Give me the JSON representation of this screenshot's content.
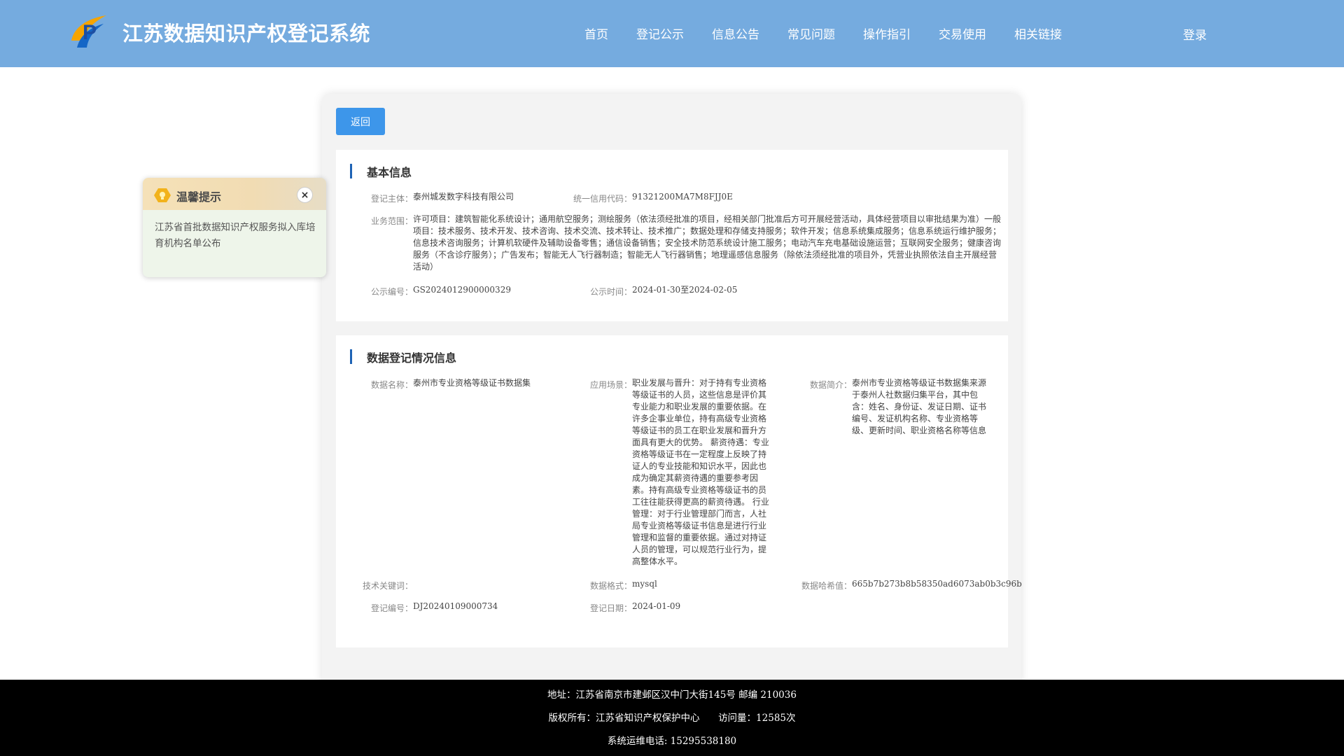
{
  "header": {
    "site_title": "江苏数据知识产权登记系统",
    "nav": [
      "首页",
      "登记公示",
      "信息公告",
      "常见问题",
      "操作指引",
      "交易使用",
      "相关链接"
    ],
    "login": "登录",
    "background": "#75abdf"
  },
  "back_button": "返回",
  "basic_info": {
    "title": "基本信息",
    "subject_label": "登记主体：",
    "subject_value": "泰州城发数字科技有限公司",
    "credit_code_label": "统一信用代码：",
    "credit_code_value": "91321200MA7M8FJJ0E",
    "scope_label": "业务范围：",
    "scope_value": "许可项目：建筑智能化系统设计；通用航空服务；测绘服务（依法须经批准的项目，经相关部门批准后方可开展经营活动，具体经营项目以审批结果为准）一般项目：技术服务、技术开发、技术咨询、技术交流、技术转让、技术推广；数据处理和存储支持服务；软件开发；信息系统集成服务；信息系统运行维护服务；信息技术咨询服务；计算机软硬件及辅助设备零售；通信设备销售；安全技术防范系统设计施工服务；电动汽车充电基础设施运营；互联网安全服务；健康咨询服务（不含诊疗服务）；广告发布；智能无人飞行器制造；智能无人飞行器销售；地理遥感信息服务（除依法须经批准的项目外，凭营业执照依法自主开展经营活动）",
    "notice_no_label": "公示编号：",
    "notice_no_value": "GS2024012900000329",
    "notice_time_label": "公示时间：",
    "notice_time_value": "2024-01-30至2024-02-05"
  },
  "data_info": {
    "title": "数据登记情况信息",
    "name_label": "数据名称：",
    "name_value": "泰州市专业资格等级证书数据集",
    "scenario_label": "应用场景：",
    "scenario_value": "职业发展与晋升：对于持有专业资格等级证书的人员，这些信息是评价其专业能力和职业发展的重要依据。在许多企事业单位，持有高级专业资格等级证书的员工在职业发展和晋升方面具有更大的优势。 薪资待遇：专业资格等级证书在一定程度上反映了持证人的专业技能和知识水平，因此也成为确定其薪资待遇的重要参考因素。持有高级专业资格等级证书的员工往往能获得更高的薪资待遇。 行业管理：对于行业管理部门而言，人社局专业资格等级证书信息是进行行业管理和监督的重要依据。通过对持证人员的管理，可以规范行业行为，提高整体水平。",
    "intro_label": "数据简介：",
    "intro_value": "泰州市专业资格等级证书数据集来源于泰州人社数据归集平台，其中包含：姓名、身份证、发证日期、证书编号、发证机构名称、专业资格等级、更新时间、职业资格名称等信息",
    "keywords_label": "技术关键词：",
    "keywords_value": "",
    "format_label": "数据格式：",
    "format_value": "mysql",
    "hash_label": "数据哈希值：",
    "hash_value": "665b7b273b8b58350ad6073ab0b3c96b",
    "reg_no_label": "登记编号：",
    "reg_no_value": "DJ20240109000734",
    "reg_date_label": "登记日期：",
    "reg_date_value": "2024-01-09"
  },
  "tip": {
    "title": "温馨提示",
    "close": "×",
    "body": "江苏省首批数据知识产权服务拟入库培育机构名单公布"
  },
  "footer": {
    "address": "地址：江苏省南京市建邺区汉中门大街145号 邮编 210036",
    "copyright": "版权所有：江苏省知识产权保护中心",
    "visits": "访问量：12585次",
    "phone": "系统运维电话: 15295538180"
  }
}
